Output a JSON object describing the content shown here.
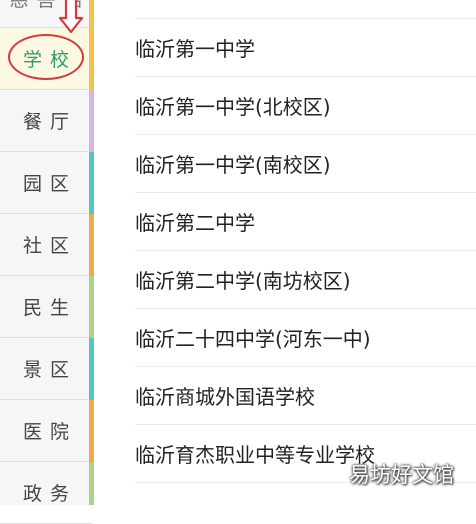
{
  "sidebar": {
    "items": [
      {
        "label": "慈菩活"
      },
      {
        "label": "学校"
      },
      {
        "label": "餐厅"
      },
      {
        "label": "园区"
      },
      {
        "label": "社区"
      },
      {
        "label": "民生"
      },
      {
        "label": "景区"
      },
      {
        "label": "医院"
      },
      {
        "label": "政务"
      }
    ],
    "active_index": 1,
    "stripe_colors": [
      "#f2c14e",
      "#d7b4e6",
      "#52c7c4",
      "#f0a94a",
      "#aad38b"
    ]
  },
  "list": {
    "items": [
      "临沂第一中学",
      "临沂第一中学(北校区)",
      "临沂第一中学(南校区)",
      "临沂第二中学",
      "临沂第二中学(南坊校区)",
      "临沂二十四中学(河东一中)",
      "临沂商城外国语学校",
      "临沂育杰职业中等专业学校"
    ]
  },
  "annotation": {
    "color": "#d23c3c"
  },
  "watermark": {
    "text": "易坊好文馆"
  }
}
